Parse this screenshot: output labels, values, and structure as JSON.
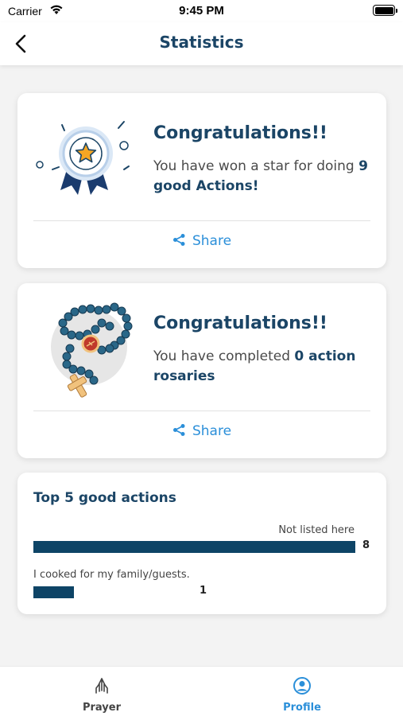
{
  "status_bar": {
    "carrier": "Carrier",
    "time": "9:45 PM"
  },
  "header": {
    "title": "Statistics"
  },
  "star_card": {
    "title": "Congratulations!!",
    "text_prefix": "You have won a star for doing ",
    "text_bold": "9 good Actions!",
    "share_label": "Share"
  },
  "rosary_card": {
    "title": "Congratulations!!",
    "text_prefix": "You have completed ",
    "text_bold": "0 action rosaries",
    "share_label": "Share"
  },
  "top_actions": {
    "title": "Top 5 good actions",
    "items": [
      {
        "label": "Not listed here",
        "value": 8
      },
      {
        "label": "I cooked for my family/guests.",
        "value": 1
      }
    ],
    "max_value": 8
  },
  "tab_bar": {
    "items": [
      {
        "label": "Prayer",
        "icon": "prayer-hands-icon",
        "active": false
      },
      {
        "label": "Profile",
        "icon": "profile-icon",
        "active": true
      }
    ]
  },
  "colors": {
    "primary": "#1b4566",
    "accent": "#2b8fd9",
    "bar": "#0e4466"
  }
}
